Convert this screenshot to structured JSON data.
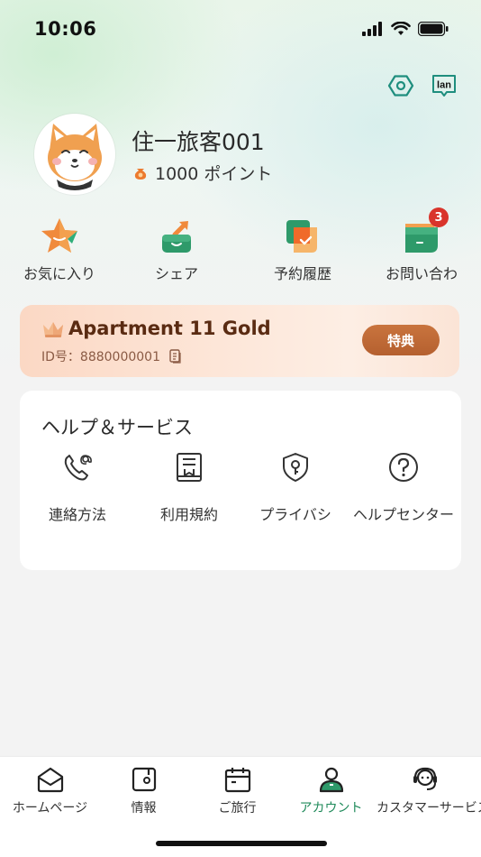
{
  "status_bar": {
    "time": "10:06"
  },
  "profile": {
    "username": "住一旅客001",
    "points": "1000 ポイント"
  },
  "quick_actions": [
    {
      "label": "お気に入り",
      "icon": "star-icon"
    },
    {
      "label": "シェア",
      "icon": "share-icon"
    },
    {
      "label": "予約履歴",
      "icon": "booking-history-icon"
    },
    {
      "label": "お問い合わ",
      "icon": "inquiry-icon",
      "badge": "3"
    }
  ],
  "membership": {
    "title": "Apartment 11 Gold",
    "id_text": "ID号：8880000001",
    "benefit_button": "特典"
  },
  "help": {
    "title": "ヘルプ＆サービス",
    "items": [
      {
        "label": "連絡方法",
        "icon": "contact-icon"
      },
      {
        "label": "利用規約",
        "icon": "terms-icon"
      },
      {
        "label": "プライバシ",
        "icon": "privacy-icon"
      },
      {
        "label": "ヘルプセンター",
        "icon": "help-center-icon"
      }
    ]
  },
  "top_actions": {
    "language": "lan"
  },
  "tabbar": {
    "tabs": [
      {
        "label": "ホームページ",
        "icon": "home-icon"
      },
      {
        "label": "情報",
        "icon": "info-icon"
      },
      {
        "label": "ご旅行",
        "icon": "calendar-icon"
      },
      {
        "label": "アカウント",
        "icon": "account-icon",
        "active": true
      },
      {
        "label": "カスタマーサービス",
        "icon": "headset-icon"
      }
    ]
  },
  "colors": {
    "accent": "#1f8a5a",
    "badge": "#d9342b",
    "gold_button": "#b5602f",
    "gold_title": "#5a2b12"
  }
}
